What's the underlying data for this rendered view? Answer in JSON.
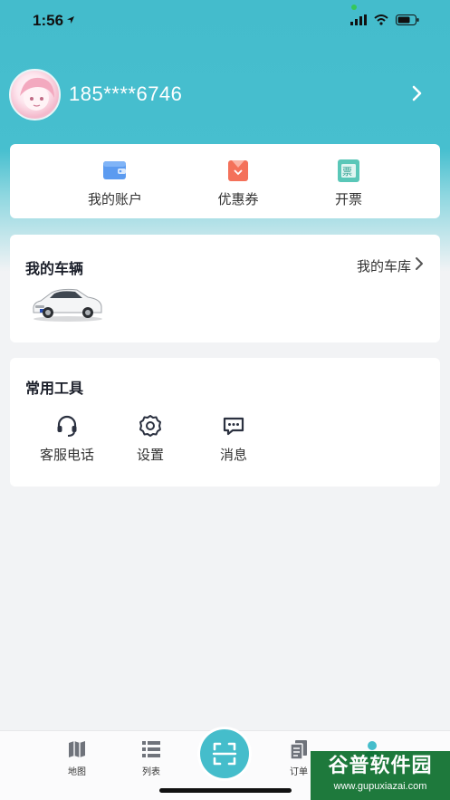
{
  "status_bar": {
    "time": "1:56"
  },
  "profile": {
    "phone": "185****6746"
  },
  "quick_actions": [
    {
      "label": "我的账户",
      "icon": "wallet-icon"
    },
    {
      "label": "优惠券",
      "icon": "coupon-icon"
    },
    {
      "label": "开票",
      "icon": "invoice-icon",
      "icon_text": "票"
    }
  ],
  "vehicle": {
    "title": "我的车辆",
    "garage_label": "我的车库"
  },
  "tools": {
    "title": "常用工具",
    "items": [
      {
        "label": "客服电话",
        "icon": "headset-icon"
      },
      {
        "label": "设置",
        "icon": "gear-icon"
      },
      {
        "label": "消息",
        "icon": "message-icon"
      }
    ]
  },
  "tabbar": {
    "items": [
      {
        "label": "地图",
        "icon": "map-icon"
      },
      {
        "label": "列表",
        "icon": "list-icon"
      },
      {
        "label": "订单",
        "icon": "order-icon"
      }
    ],
    "scan_icon": "scan-icon",
    "profile_icon": "person-icon"
  },
  "watermark": {
    "title": "谷普软件园",
    "url": "www.gupuxiazai.com"
  },
  "colors": {
    "accent": "#45bdcb",
    "card": "#ffffff",
    "background": "#f2f3f5"
  }
}
